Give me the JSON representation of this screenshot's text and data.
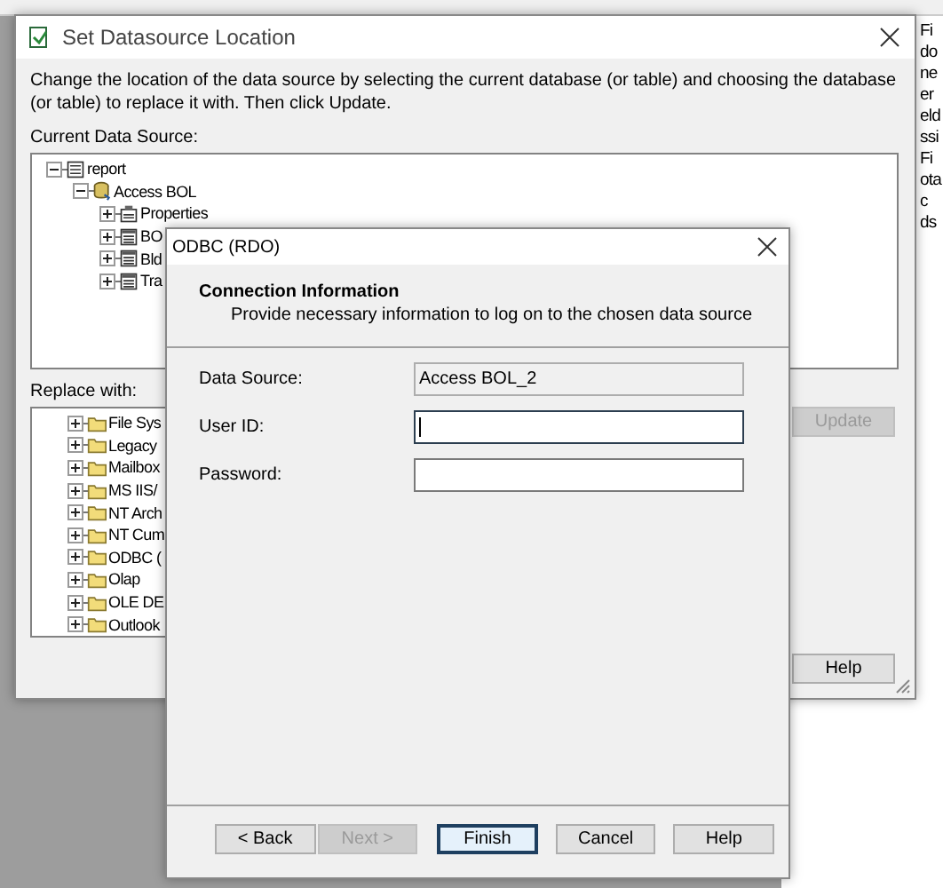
{
  "background_document": {
    "fragments": [
      "Fi",
      "do",
      "ne",
      "er",
      "eld",
      "ssi",
      "Fi",
      "ota",
      "c",
      "ds"
    ]
  },
  "main_window": {
    "title": "Set Datasource Location",
    "description": "Change the location of the data source by selecting the current database (or table) and choosing the database (or table) to replace it with.  Then click Update.",
    "current_label": "Current Data Source:",
    "current_tree": [
      {
        "label": "report",
        "kind": "report",
        "expanded": true,
        "children": [
          {
            "label": "Access BOL",
            "kind": "database",
            "expanded": true,
            "children": [
              {
                "label": "Properties",
                "kind": "properties",
                "expanded": false
              },
              {
                "label": "BO",
                "kind": "table",
                "expanded": false
              },
              {
                "label": "Bld",
                "kind": "table",
                "expanded": false
              },
              {
                "label": "Tra",
                "kind": "table",
                "expanded": false
              }
            ]
          }
        ]
      }
    ],
    "replace_label": "Replace with:",
    "replace_tree": [
      {
        "label": "File Sys",
        "kind": "folder",
        "expanded": false
      },
      {
        "label": "Legacy",
        "kind": "folder",
        "expanded": false
      },
      {
        "label": "Mailbox",
        "kind": "folder",
        "expanded": false
      },
      {
        "label": "MS IIS/",
        "kind": "folder",
        "expanded": false
      },
      {
        "label": "NT Arch",
        "kind": "folder",
        "expanded": false
      },
      {
        "label": "NT Cum",
        "kind": "folder",
        "expanded": false
      },
      {
        "label": "ODBC (",
        "kind": "folder",
        "expanded": false
      },
      {
        "label": "Olap",
        "kind": "folder",
        "expanded": false
      },
      {
        "label": "OLE DE",
        "kind": "folder",
        "expanded": false
      },
      {
        "label": "Outlook",
        "kind": "folder",
        "expanded": false
      }
    ],
    "buttons": [
      {
        "label": "Update",
        "disabled": true
      },
      {
        "label": "Help",
        "disabled": false
      }
    ]
  },
  "odbc_dialog": {
    "title": "ODBC (RDO)",
    "heading": "Connection Information",
    "subheading": "Provide necessary information to log on to the chosen data source",
    "fields": [
      {
        "label": "Data Source:",
        "value": "Access BOL_2",
        "readonly": true,
        "focused": false
      },
      {
        "label": "User ID:",
        "readonly": false,
        "focused": true
      },
      {
        "label": "Password:",
        "readonly": false,
        "focused": false
      }
    ],
    "buttons": [
      {
        "label": "< Back",
        "disabled": false,
        "default": false
      },
      {
        "label": "Next >",
        "disabled": true,
        "default": false
      },
      {
        "label": "Finish",
        "disabled": false,
        "default": true
      },
      {
        "label": "Cancel",
        "disabled": false,
        "default": false
      },
      {
        "label": "Help",
        "disabled": false,
        "default": false
      }
    ]
  }
}
